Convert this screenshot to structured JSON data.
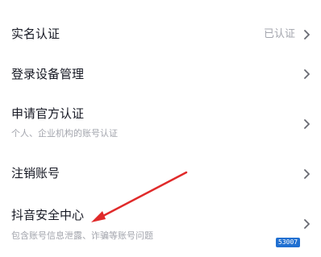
{
  "rows": [
    {
      "title": "实名认证",
      "value": "已认证"
    },
    {
      "title": "登录设备管理"
    },
    {
      "title": "申请官方认证",
      "subtitle": "个人、企业机构的账号认证"
    },
    {
      "title": "注销账号"
    },
    {
      "title": "抖音安全中心",
      "subtitle": "包含账号信息泄露、诈骗等账号问题"
    }
  ],
  "watermark": {
    "text": "53007"
  },
  "colors": {
    "primary_text": "#161823",
    "secondary_text": "#a3a5ad",
    "chevron": "#686a72",
    "annotation_arrow": "#e02a2a"
  }
}
